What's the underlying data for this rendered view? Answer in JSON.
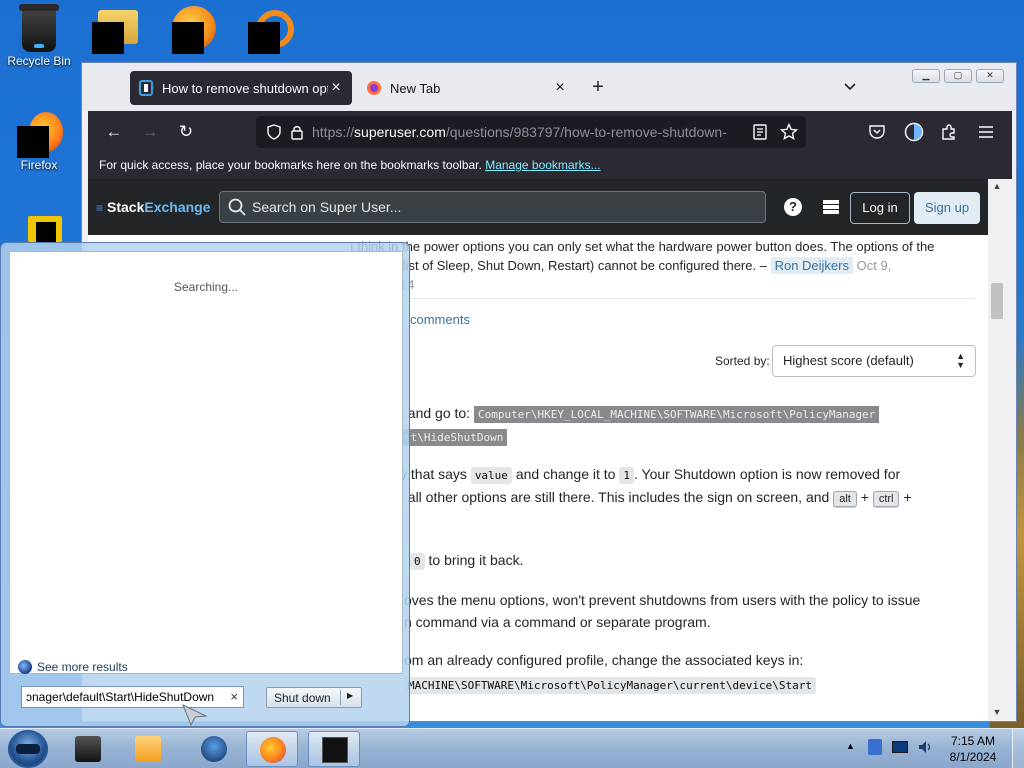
{
  "desktop": {
    "recycle_bin_label": "Recycle Bin",
    "firefox_label": "Firefox"
  },
  "browser": {
    "tabs": [
      {
        "title": "How to remove shutdown optic",
        "active": true
      },
      {
        "title": "New Tab",
        "active": false
      }
    ],
    "url": {
      "scheme": "https://",
      "host": "superuser.com",
      "path": "/questions/983797/how-to-remove-shutdown-"
    },
    "bookmarks_hint": "For quick access, place your bookmarks here on the bookmarks toolbar.",
    "bookmarks_link": "Manage bookmarks..."
  },
  "site": {
    "logo_stack": "Stack",
    "logo_exchange": "Exchange",
    "search_placeholder": "Search on Super User...",
    "login": "Log in",
    "signup": "Sign up"
  },
  "content": {
    "comment_line1": "I think in the power options you can only set what the hardware power button does. The options of the",
    "comment_line2": "n (select list of Sleep, Shut Down, Restart) cannot be configured there. –",
    "comment_user": "Ron Deijkers",
    "comment_date_a": "Oct 9,",
    "comment_date_b": "14",
    "more_comments": "comments",
    "sorted_by_label": "Sorted by:",
    "sort_value": "Highest score (default)",
    "p1_text": "t and go to:",
    "p1_code_a": "Computer\\HKEY_LOCAL_MACHINE\\SOFTWARE\\Microsoft\\PolicyManager",
    "p1_code_b": "rt\\HideShutDown",
    "p2_a": "y that says",
    "p2_code_value": "value",
    "p2_b": "and change it to",
    "p2_code_1": "1",
    "p2_c": ". Your Shutdown option is now removed for",
    "p2_line2": "t all other options are still there. This includes the sign on screen, and",
    "kbd_alt": "alt",
    "kbd_ctrl": "ctrl",
    "plus": "+",
    "p3_code_0": "0",
    "p3_text": "to bring it back.",
    "p4_line1": "oves the menu options, won't prevent shutdowns from users with the policy to issue",
    "p4_line2": "n command via a command or separate program.",
    "p5_line1": "om an already configured profile, change the associated keys in:",
    "p5_code": "MACHINE\\SOFTWARE\\Microsoft\\PolicyManager\\current\\device\\Start"
  },
  "start_menu": {
    "status": "Searching...",
    "see_more": "See more results",
    "search_value": "ɔnager\\default\\Start\\HideShutDown",
    "shutdown_label": "Shut down"
  },
  "taskbar": {
    "time": "7:15 AM",
    "date": "8/1/2024"
  }
}
